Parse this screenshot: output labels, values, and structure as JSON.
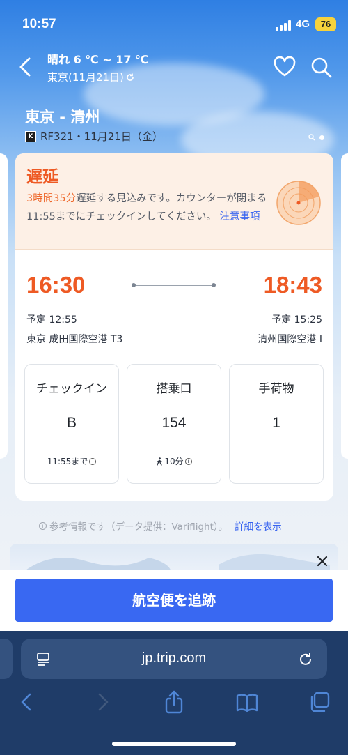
{
  "status_bar": {
    "time": "10:57",
    "network": "4G",
    "battery": "76"
  },
  "header": {
    "weather": "晴れ 6 ℃ ~ 17 ℃",
    "location_date": "東京(11月21日)",
    "route": "東京 - 清州",
    "airline_logo_text": "K",
    "flight_info": "RF321・11月21日（金）"
  },
  "delay": {
    "title": "遅延",
    "message_prefix": "3時間35分",
    "message_body": "遅延する見込みです。カウンターが閉まる11:55までにチェックインしてください。",
    "notice_link": "注意事項"
  },
  "flight": {
    "departure_time": "16:30",
    "arrival_time": "18:43",
    "scheduled_departure": "予定 12:55",
    "scheduled_arrival": "予定 15:25",
    "departure_airport": "東京 成田国際空港 T3",
    "arrival_airport": "清州国際空港 I"
  },
  "info_boxes": [
    {
      "label": "チェックイン",
      "value": "B",
      "sub": "11:55まで"
    },
    {
      "label": "搭乗口",
      "value": "154",
      "sub": "10分"
    },
    {
      "label": "手荷物",
      "value": "1",
      "sub": ""
    }
  ],
  "reference": {
    "note": "参考情報です（データ提供：Variflight）。",
    "details_link": "詳細を表示"
  },
  "track_button": "航空便を追跡",
  "browser": {
    "url": "jp.trip.com"
  },
  "colors": {
    "accent": "#ee5a24",
    "primary_button": "#3968f2",
    "safari_bar": "#1f3c68"
  }
}
